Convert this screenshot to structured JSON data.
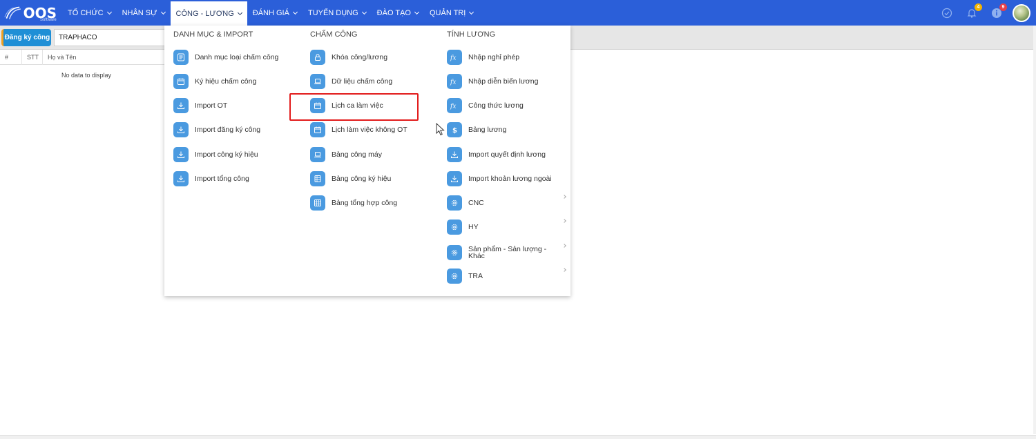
{
  "logo": {
    "text": "OOS",
    "sub": "Software"
  },
  "nav": [
    {
      "label": "TỔ CHỨC",
      "active": false
    },
    {
      "label": "NHÂN SỰ",
      "active": false
    },
    {
      "label": "CÔNG - LƯƠNG",
      "active": true
    },
    {
      "label": "ĐÁNH GIÁ",
      "active": false
    },
    {
      "label": "TUYỂN DỤNG",
      "active": false
    },
    {
      "label": "ĐÀO TẠO",
      "active": false
    },
    {
      "label": "QUẢN TRỊ",
      "active": false
    }
  ],
  "notifications": {
    "bell_count": "4",
    "info_count": "9",
    "bell_color": "#f5b400",
    "info_color": "#e8404a"
  },
  "subbar": {
    "register_label": "Đăng ký công",
    "company_value": "TRAPHACO"
  },
  "grid": {
    "columns": [
      "#",
      "STT",
      "Họ và Tên"
    ],
    "empty_text": "No data to display"
  },
  "menu": {
    "col1": {
      "title": "DANH MỤC & IMPORT",
      "items": [
        {
          "label": "Danh mục loại chấm công",
          "icon": "list-icon"
        },
        {
          "label": "Ký hiệu chấm công",
          "icon": "calendar-icon"
        },
        {
          "label": "Import OT",
          "icon": "download-icon"
        },
        {
          "label": "Import đăng ký công",
          "icon": "download-icon"
        },
        {
          "label": "Import công ký hiệu",
          "icon": "download-icon"
        },
        {
          "label": "Import tổng công",
          "icon": "download-icon"
        }
      ]
    },
    "col2": {
      "title": "CHẤM CÔNG",
      "items": [
        {
          "label": "Khóa công/lương",
          "icon": "lock-icon"
        },
        {
          "label": "Dữ liệu chấm công",
          "icon": "laptop-icon"
        },
        {
          "label": "Lịch ca làm việc",
          "icon": "calendar-icon"
        },
        {
          "label": "Lịch làm việc không OT",
          "icon": "calendar-icon"
        },
        {
          "label": "Bảng công máy",
          "icon": "laptop-icon"
        },
        {
          "label": "Bảng công ký hiệu",
          "icon": "sheet-icon"
        },
        {
          "label": "Bảng tổng hợp công",
          "icon": "grid-icon"
        }
      ]
    },
    "col3": {
      "title": "TÍNH LƯƠNG",
      "items": [
        {
          "label": "Nhập nghỉ phép",
          "icon": "fx-icon"
        },
        {
          "label": "Nhập diễn biến lương",
          "icon": "fx-icon"
        },
        {
          "label": "Công thức lương",
          "icon": "fx-icon"
        },
        {
          "label": "Bảng lương",
          "icon": "dollar-icon"
        },
        {
          "label": "Import quyết định lương",
          "icon": "download-icon"
        },
        {
          "label": "Import khoản lương ngoài",
          "icon": "download-icon"
        },
        {
          "label": "CNC",
          "icon": "gear-icon",
          "submenu": true
        },
        {
          "label": "HY",
          "icon": "gear-icon",
          "submenu": true
        },
        {
          "label": "Sản phẩm - Sản lượng - Khác",
          "icon": "gear-icon",
          "submenu": true
        },
        {
          "label": "TRA",
          "icon": "gear-icon",
          "submenu": true
        }
      ]
    }
  },
  "colors": {
    "topbar": "#2b5fd9",
    "menu_icon": "#4a9ae0",
    "highlight": "#e21b1b",
    "register_button": "#1f8fd6"
  }
}
